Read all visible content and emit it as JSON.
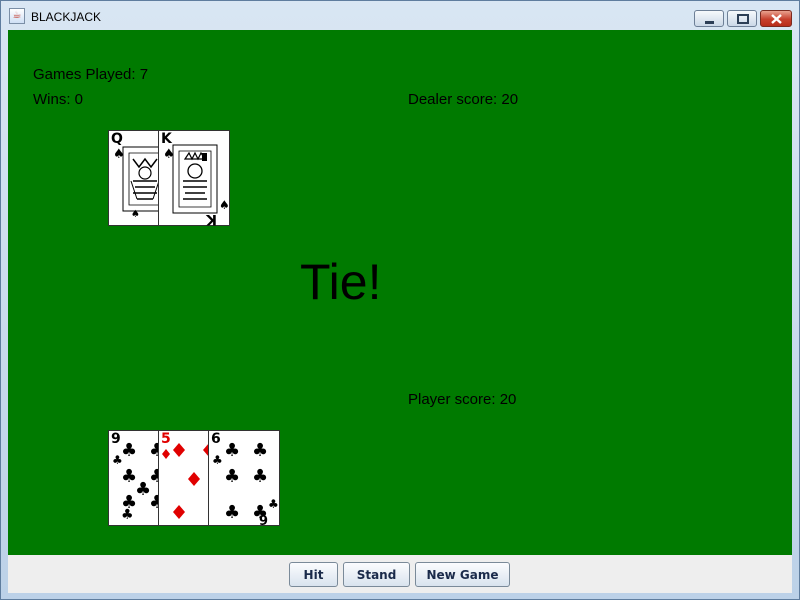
{
  "window": {
    "title": "BLACKJACK"
  },
  "stats": {
    "games_played": "Games Played: 7",
    "wins": "Wins: 0"
  },
  "dealer": {
    "score": "Dealer score: 20",
    "cards": [
      {
        "rank": "Q",
        "suit": "spades",
        "color": "#000000"
      },
      {
        "rank": "K",
        "suit": "spades",
        "color": "#000000"
      }
    ]
  },
  "player": {
    "score": "Player score: 20",
    "cards": [
      {
        "rank": "9",
        "suit": "clubs",
        "color": "#000000"
      },
      {
        "rank": "5",
        "suit": "diamonds",
        "color": "#e00000"
      },
      {
        "rank": "6",
        "suit": "clubs",
        "color": "#000000"
      }
    ]
  },
  "result": "Tie!",
  "buttons": {
    "hit": "Hit",
    "stand": "Stand",
    "new_game": "New Game"
  },
  "colors": {
    "table": "#007a00",
    "red_suit": "#e00000"
  }
}
